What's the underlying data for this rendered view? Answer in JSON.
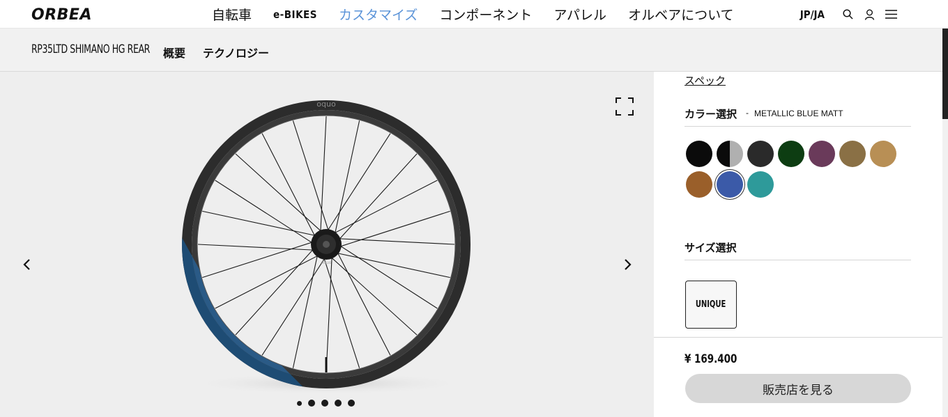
{
  "brand": {
    "logo_text": "ORBEA"
  },
  "nav": {
    "items": [
      {
        "label": "自転車"
      },
      {
        "label": "e-BIKES"
      },
      {
        "label": "カスタマイズ"
      },
      {
        "label": "コンポーネント"
      },
      {
        "label": "アパレル"
      },
      {
        "label": "オルベアについて"
      }
    ],
    "active_index": 2,
    "active_color": "#5a93d8",
    "language": "JP/JA",
    "icons": [
      "search-icon",
      "user-icon",
      "menu-icon"
    ]
  },
  "subheader": {
    "product_name": "RP35LTD SHIMANO HG REAR",
    "tabs": [
      {
        "label": "概要"
      },
      {
        "label": "テクノロジー"
      }
    ]
  },
  "gallery": {
    "rim_brand": "oquo",
    "hub_label": "oquo",
    "dot_count": 5,
    "active_dot": 0,
    "icons": [
      "prev-arrow-icon",
      "next-arrow-icon",
      "fullscreen-icon"
    ]
  },
  "config": {
    "spec_link": "スペック",
    "color_title": "カラー選択",
    "color_separator": "-",
    "selected_color_name": "METALLIC BLUE MATT",
    "colors": [
      {
        "hex": "#0b0b0b"
      },
      {
        "hex": "split-black-grey"
      },
      {
        "hex": "#2a2a2a"
      },
      {
        "hex": "#0d3d12"
      },
      {
        "hex": "#6a3a5a"
      },
      {
        "hex": "#8a7045"
      },
      {
        "hex": "#b88f55"
      },
      {
        "hex": "#9a5f2a"
      },
      {
        "hex": "#3b5aa8"
      },
      {
        "hex": "#2e9a9a"
      }
    ],
    "selected_color_index": 8,
    "size_title": "サイズ選択",
    "sizes": [
      {
        "label": "UNIQUE"
      }
    ],
    "price": "¥ 169.400",
    "dealer_button": "販売店を見る"
  }
}
